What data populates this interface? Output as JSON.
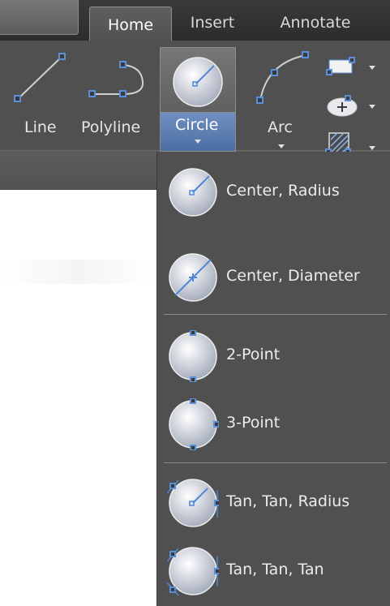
{
  "tabs": {
    "home": "Home",
    "insert": "Insert",
    "annotate": "Annotate"
  },
  "tools": {
    "line": "Line",
    "polyline": "Polyline",
    "circle": "Circle",
    "arc": "Arc"
  },
  "circle_menu": {
    "items": [
      {
        "label": "Center, Radius",
        "icon": "circle-center-radius-icon"
      },
      {
        "label": "Center, Diameter",
        "icon": "circle-center-diameter-icon"
      },
      {
        "label": "2-Point",
        "icon": "circle-2-point-icon"
      },
      {
        "label": "3-Point",
        "icon": "circle-3-point-icon"
      },
      {
        "label": "Tan, Tan, Radius",
        "icon": "circle-tan-tan-radius-icon"
      },
      {
        "label": "Tan, Tan, Tan",
        "icon": "circle-tan-tan-tan-icon"
      }
    ]
  },
  "colors": {
    "ribbon_bg": "#505050",
    "circle_button_active": "#4b6ea3",
    "tool_accent": "#5b8fd8"
  }
}
